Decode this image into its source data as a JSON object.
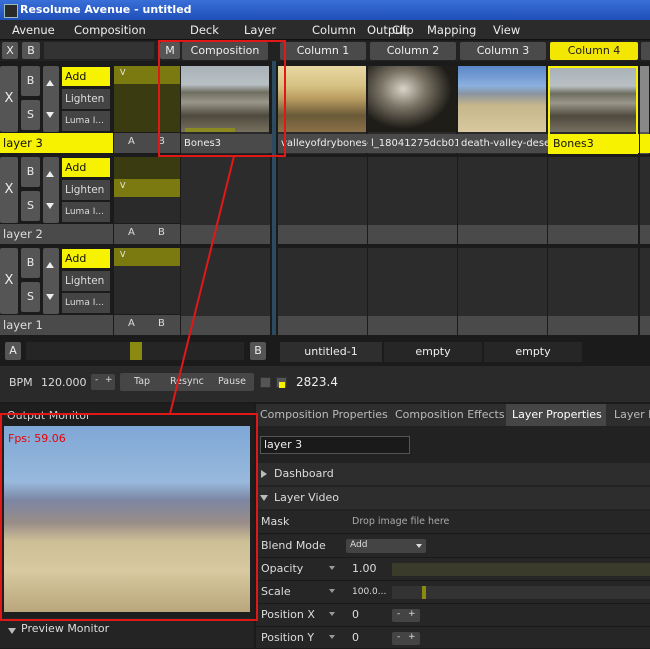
{
  "window": {
    "title": "Resolume Avenue - untitled"
  },
  "menu": [
    "Avenue",
    "Composition",
    "Deck",
    "Layer",
    "Column",
    "Clip",
    "Output",
    "Mapping",
    "View"
  ],
  "columns": {
    "x_label": "X",
    "b_label": "B",
    "m_label": "M",
    "composition_label": "Composition",
    "headers": [
      "Column 1",
      "Column 2",
      "Column 3",
      "Column 4"
    ]
  },
  "layers": [
    {
      "name": "layer 3",
      "blend": "Add",
      "blend2": "Lighten",
      "blend3": "Luma I...",
      "x": "X",
      "b": "B",
      "s": "S",
      "v": "V",
      "a": "A",
      "bb": "B"
    },
    {
      "name": "layer 2",
      "blend": "Add",
      "blend2": "Lighten",
      "blend3": "Luma I...",
      "x": "X",
      "b": "B",
      "s": "S",
      "v": "V",
      "a": "A",
      "bb": "B"
    },
    {
      "name": "layer 1",
      "blend": "Add",
      "blend2": "Lighten",
      "blend3": "Luma I...",
      "x": "X",
      "b": "B",
      "s": "S",
      "v": "V",
      "a": "A",
      "bb": "B"
    }
  ],
  "clips": [
    {
      "name": "Bones3"
    },
    {
      "name": "valleyofdrybones-f..."
    },
    {
      "name": "l_18041275dcb01c..."
    },
    {
      "name": "death-valley-desert"
    },
    {
      "name": "Bones3"
    }
  ],
  "crossfader": {
    "a": "A",
    "b": "B",
    "decks": [
      "untitled-1",
      "empty",
      "empty"
    ]
  },
  "transport": {
    "bpm_label": "BPM",
    "bpm_value": "120.000",
    "minus": "-",
    "plus": "+",
    "tap": "Tap",
    "resync": "Resync",
    "pause": "Pause",
    "time": "2823.4"
  },
  "output_monitor": {
    "title": "Output Monitor",
    "fps": "Fps: 59.06"
  },
  "preview_monitor": {
    "title": "Preview Monitor"
  },
  "tabs": [
    "Composition Properties",
    "Composition Effects",
    "Layer Properties",
    "Layer E"
  ],
  "props": {
    "layer_name": "layer 3",
    "dashboard": "Dashboard",
    "layer_video": "Layer Video",
    "mask_label": "Mask",
    "mask_hint": "Drop image file here",
    "blend_label": "Blend Mode",
    "blend_value": "Add",
    "opacity_label": "Opacity",
    "opacity_value": "1.00",
    "scale_label": "Scale",
    "scale_value": "100.0...",
    "posx_label": "Position X",
    "posx_value": "0",
    "posy_label": "Position Y",
    "posy_value": "0",
    "minus": "-",
    "plus": "+"
  },
  "colors": {
    "accent": "#f7f200",
    "annotation": "#e01818",
    "title_bar": "#2f62cc"
  }
}
